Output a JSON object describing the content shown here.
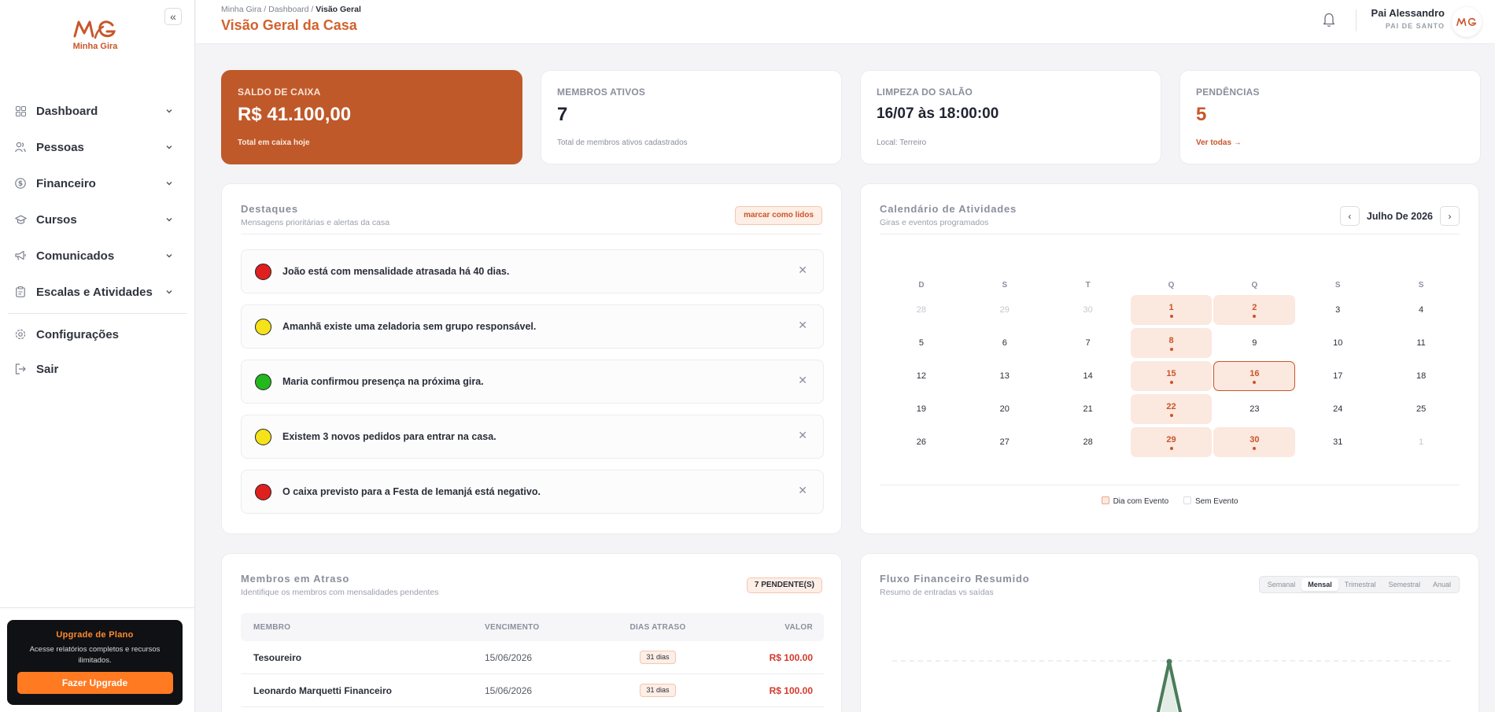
{
  "app": {
    "logo_text": "Minha Gira"
  },
  "sidebar": {
    "items": [
      {
        "label": "Dashboard",
        "icon": "grid-icon"
      },
      {
        "label": "Pessoas",
        "icon": "users-icon"
      },
      {
        "label": "Financeiro",
        "icon": "dollar-icon"
      },
      {
        "label": "Cursos",
        "icon": "graduation-cap-icon"
      },
      {
        "label": "Comunicados",
        "icon": "megaphone-icon"
      },
      {
        "label": "Escalas e Atividades",
        "icon": "clipboard-icon"
      }
    ],
    "settings_label": "Configurações",
    "logout_label": "Sair",
    "upgrade": {
      "title": "Upgrade de Plano",
      "description": "Acesse relatórios completos e recursos ilimitados.",
      "button": "Fazer Upgrade"
    }
  },
  "header": {
    "breadcrumb": [
      "Minha Gira",
      "Dashboard",
      "Visão Geral"
    ],
    "title": "Visão Geral da Casa",
    "user_name": "Pai Alessandro",
    "user_role": "PAI DE SANTO"
  },
  "stats": {
    "balance": {
      "label": "SALDO DE CAIXA",
      "value": "R$ 41.100,00",
      "sub": "Total em caixa hoje"
    },
    "members": {
      "label": "MEMBROS ATIVOS",
      "value": "7",
      "sub": "Total de membros ativos cadastrados"
    },
    "cleaning": {
      "label": "LIMPEZA DO SALÃO",
      "value": "16/07 às 18:00:00",
      "sub": "Local: Terreiro"
    },
    "pending": {
      "label": "PENDÊNCIAS",
      "value": "5",
      "sub": "Ver todas →"
    }
  },
  "highlights": {
    "title": "Destaques",
    "subtitle": "Mensagens prioritárias e alertas da casa",
    "mark_read": "marcar como lidos",
    "alerts": [
      {
        "text": "João está com mensalidade atrasada há 40 dias.",
        "color": "#e0201f"
      },
      {
        "text": "Amanhã existe uma zeladoria sem grupo responsável.",
        "color": "#f5e21a"
      },
      {
        "text": "Maria confirmou presença na próxima gira.",
        "color": "#22b81e"
      },
      {
        "text": "Existem 3 novos pedidos para entrar na casa.",
        "color": "#f5e21a"
      },
      {
        "text": "O caixa previsto para a Festa de Iemanjá está negativo.",
        "color": "#e0201f"
      }
    ]
  },
  "calendar": {
    "title": "Calendário de Atividades",
    "subtitle": "Giras e eventos programados",
    "month": "Julho De 2026",
    "weekdays": [
      "D",
      "S",
      "T",
      "Q",
      "Q",
      "S",
      "S"
    ],
    "weeks": [
      [
        {
          "d": "28",
          "m": true
        },
        {
          "d": "29",
          "m": true
        },
        {
          "d": "30",
          "m": true
        },
        {
          "d": "1",
          "e": true
        },
        {
          "d": "2",
          "e": true
        },
        {
          "d": "3"
        },
        {
          "d": "4"
        }
      ],
      [
        {
          "d": "5"
        },
        {
          "d": "6"
        },
        {
          "d": "7"
        },
        {
          "d": "8",
          "e": true
        },
        {
          "d": "9"
        },
        {
          "d": "10"
        },
        {
          "d": "11"
        }
      ],
      [
        {
          "d": "12"
        },
        {
          "d": "13"
        },
        {
          "d": "14"
        },
        {
          "d": "15",
          "e": true
        },
        {
          "d": "16",
          "e": true,
          "t": true
        },
        {
          "d": "17"
        },
        {
          "d": "18"
        }
      ],
      [
        {
          "d": "19"
        },
        {
          "d": "20"
        },
        {
          "d": "21"
        },
        {
          "d": "22",
          "e": true
        },
        {
          "d": "23"
        },
        {
          "d": "24"
        },
        {
          "d": "25"
        }
      ],
      [
        {
          "d": "26"
        },
        {
          "d": "27"
        },
        {
          "d": "28"
        },
        {
          "d": "29",
          "e": true
        },
        {
          "d": "30",
          "e": true
        },
        {
          "d": "31"
        },
        {
          "d": "1",
          "m": true
        }
      ]
    ],
    "legend_event": "Dia com Evento",
    "legend_none": "Sem Evento"
  },
  "overdue": {
    "title": "Membros em Atraso",
    "subtitle": "Identifique os membros com mensalidades pendentes",
    "badge": "7 PENDENTE(S)",
    "columns": [
      "MEMBRO",
      "VENCIMENTO",
      "DIAS ATRASO",
      "VALOR"
    ],
    "rows": [
      {
        "member": "Tesoureiro",
        "due": "15/06/2026",
        "days": "31 dias",
        "value": "R$ 100.00"
      },
      {
        "member": "Leonardo Marquetti Financeiro",
        "due": "15/06/2026",
        "days": "31 dias",
        "value": "R$ 100.00"
      }
    ]
  },
  "finance": {
    "title": "Fluxo Financeiro Resumido",
    "subtitle": "Resumo de entradas vs saídas",
    "periods": [
      "Semanal",
      "Mensal",
      "Trimestral",
      "Semestral",
      "Anual"
    ],
    "active_period": "Mensal"
  },
  "colors": {
    "brand": "#c8562a",
    "balance_card": "#bf592a",
    "chart_line": "#4a7c59"
  }
}
